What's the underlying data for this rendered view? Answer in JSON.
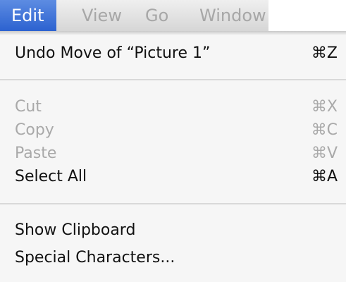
{
  "menubar": {
    "items": [
      {
        "label": "Edit"
      },
      {
        "label": "View"
      },
      {
        "label": "Go"
      },
      {
        "label": "Window"
      }
    ],
    "active_color": "#3a6fd8"
  },
  "edit_menu": {
    "undo": {
      "label": "Undo Move of “Picture 1”",
      "shortcut": "⌘Z",
      "enabled": true
    },
    "cut": {
      "label": "Cut",
      "shortcut": "⌘X",
      "enabled": false
    },
    "copy": {
      "label": "Copy",
      "shortcut": "⌘C",
      "enabled": false
    },
    "paste": {
      "label": "Paste",
      "shortcut": "⌘V",
      "enabled": false
    },
    "select_all": {
      "label": "Select All",
      "shortcut": "⌘A",
      "enabled": true
    },
    "show_clipboard": {
      "label": "Show Clipboard",
      "enabled": true
    },
    "special_characters": {
      "label": "Special Characters...",
      "enabled": true
    }
  }
}
